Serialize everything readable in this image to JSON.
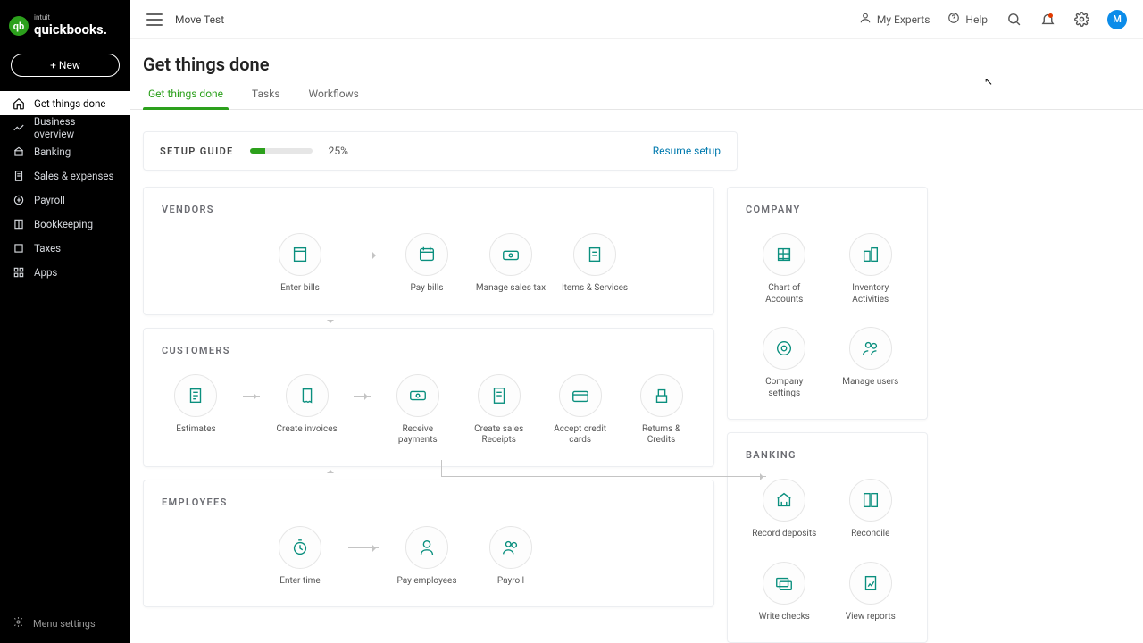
{
  "logo": {
    "intuit": "intuit",
    "brand": "quickbooks."
  },
  "newButton": "+  New",
  "sidebar": {
    "items": [
      {
        "label": "Get things done",
        "icon": "home"
      },
      {
        "label": "Business overview",
        "icon": "chart"
      },
      {
        "label": "Banking",
        "icon": "bank"
      },
      {
        "label": "Sales & expenses",
        "icon": "receipt"
      },
      {
        "label": "Payroll",
        "icon": "pay"
      },
      {
        "label": "Bookkeeping",
        "icon": "book"
      },
      {
        "label": "Taxes",
        "icon": "tax"
      },
      {
        "label": "Apps",
        "icon": "apps"
      }
    ],
    "footer": "Menu settings"
  },
  "topbar": {
    "company": "Move Test",
    "myExperts": "My Experts",
    "help": "Help",
    "avatar": "M"
  },
  "page": {
    "title": "Get things done",
    "tabs": [
      "Get things done",
      "Tasks",
      "Workflows"
    ]
  },
  "setup": {
    "label": "SETUP GUIDE",
    "percent": "25%",
    "percentVal": 25,
    "resume": "Resume setup"
  },
  "sections": {
    "vendors": {
      "title": "VENDORS",
      "items": [
        "Enter bills",
        "Pay bills",
        "Manage sales tax",
        "Items & Services"
      ]
    },
    "customers": {
      "title": "CUSTOMERS",
      "items": [
        "Estimates",
        "Create invoices",
        "Receive payments",
        "Create sales Receipts",
        "Accept credit cards",
        "Returns & Credits"
      ]
    },
    "employees": {
      "title": "EMPLOYEES",
      "items": [
        "Enter time",
        "Pay employees",
        "Payroll"
      ]
    },
    "company": {
      "title": "COMPANY",
      "items": [
        "Chart of Accounts",
        "Inventory Activities",
        "Company settings",
        "Manage users"
      ]
    },
    "banking": {
      "title": "BANKING",
      "items": [
        "Record deposits",
        "Reconcile",
        "Write checks",
        "View reports"
      ]
    }
  }
}
